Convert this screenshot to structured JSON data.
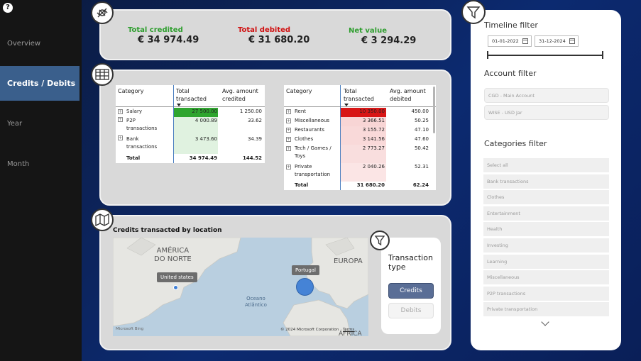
{
  "sidebar": {
    "items": [
      {
        "label": "Overview"
      },
      {
        "label": "Credits / Debits"
      },
      {
        "label": "Year"
      },
      {
        "label": "Month"
      }
    ]
  },
  "kpis": {
    "credited_label": "Total credited",
    "credited_value": "€ 34 974.49",
    "debited_label": "Total debited",
    "debited_value": "€ 31 680.20",
    "net_label": "Net value",
    "net_value": "€ 3 294.29"
  },
  "credits_table": {
    "headers": [
      "Category",
      "Total transacted",
      "Avg. amount credited"
    ],
    "rows": [
      {
        "category": "Salary",
        "total": "27 500.00",
        "avg": "1 250.00",
        "level": 1.0
      },
      {
        "category": "P2P transactions",
        "total": "4 000.89",
        "avg": "33.62",
        "level": 0.145
      },
      {
        "category": "Bank transactions",
        "total": "3 473.60",
        "avg": "34.39",
        "level": 0.126
      }
    ],
    "total_label": "Total",
    "total_value": "34 974.49",
    "total_avg": "144.52"
  },
  "debits_table": {
    "headers": [
      "Category",
      "Total transacted",
      "Avg. amount debited"
    ],
    "rows": [
      {
        "category": "Rent",
        "total": "10 350.00",
        "avg": "450.00",
        "level": 1.0
      },
      {
        "category": "Miscellaneous",
        "total": "3 366.51",
        "avg": "50.25",
        "level": 0.325
      },
      {
        "category": "Restaurants",
        "total": "3 155.72",
        "avg": "47.10",
        "level": 0.305
      },
      {
        "category": "Clothes",
        "total": "3 141.56",
        "avg": "47.60",
        "level": 0.303
      },
      {
        "category": "Tech / Games / Toys",
        "total": "2 773.27",
        "avg": "50.42",
        "level": 0.268
      },
      {
        "category": "Private transportation",
        "total": "2 040.26",
        "avg": "52.31",
        "level": 0.197
      }
    ],
    "total_label": "Total",
    "total_value": "31 680.20",
    "total_avg": "62.24"
  },
  "map": {
    "title": "Credits transacted by location",
    "label_na": "AMÉRICA\nDO NORTE",
    "label_eu": "EUROPA",
    "label_ocean": "Oceano\nAtlântico",
    "label_africa": "ÁFRICA",
    "tooltip_us": "United states",
    "tooltip_pt": "Portugal",
    "attribution_left": "Microsoft Bing",
    "attribution_right": "© 2024 Microsoft Corporation",
    "terms": "Terms"
  },
  "transaction_type": {
    "title": "Transaction type",
    "options": [
      "Credits",
      "Debits"
    ],
    "selected": "Credits"
  },
  "filters": {
    "timeline_heading": "Timeline filter",
    "date_start": "01-01-2022",
    "date_end": "31-12-2024",
    "account_heading": "Account filter",
    "accounts": [
      "CGD - Main Account",
      "WISE - USD Jar"
    ],
    "categories_heading": "Categories filter",
    "categories": [
      "Select all",
      "Bank transactions",
      "Clothes",
      "Entertainment",
      "Health",
      "Investing",
      "Learning",
      "Miscellaneous",
      "P2P transactions",
      "Private transportation"
    ]
  },
  "colors": {
    "credit": "#2e9e2e",
    "debit": "#d01010",
    "net": "#2e9e2e",
    "credit_bar": "#2ea52e",
    "debit_bar": "#d81515",
    "selected_button": "#5a6e96"
  }
}
